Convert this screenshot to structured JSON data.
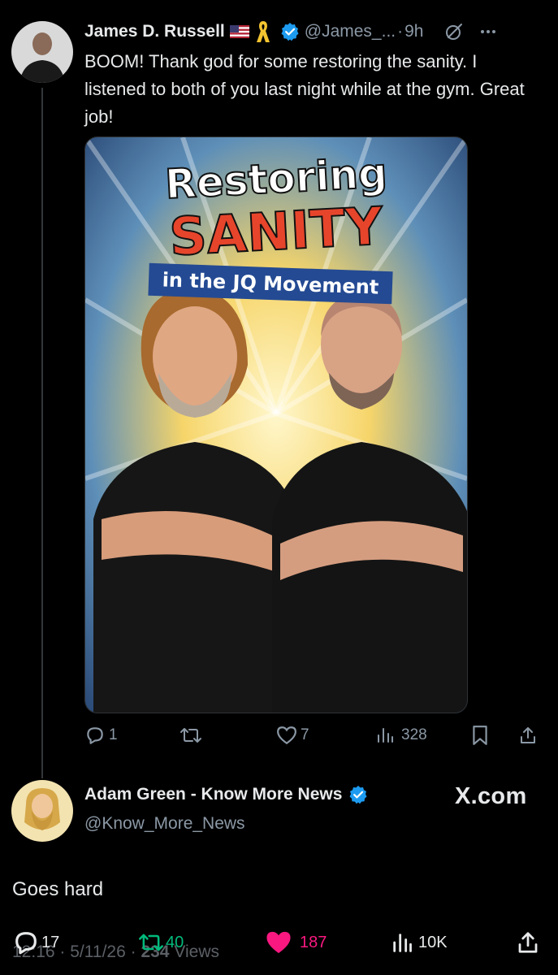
{
  "tweet1": {
    "author_name": "James D. Russell",
    "flag_icon": "us-flag-icon",
    "ribbon_icon": "ribbon-icon",
    "handle": "@James_...",
    "separator": "·",
    "time": "9h",
    "text": "BOOM! Thank god for some restoring the sanity. I listened to both of you last night while at the gym. Great job!",
    "media": {
      "title_line1": "Restoring",
      "title_line2": "SANITY",
      "banner": "in the JQ Movement"
    },
    "actions": {
      "replies": "1",
      "reposts": "",
      "likes": "7",
      "views": "328"
    }
  },
  "tweet2": {
    "author_name": "Adam Green - Know More News",
    "handle": "@Know_More_News",
    "brand": "X.com",
    "text": "Goes hard",
    "meta": {
      "time": "12:16",
      "date": "5/11/26",
      "views_count": "234",
      "views_label": "Views",
      "separator": "·"
    },
    "actions": {
      "replies": "17",
      "reposts": "40",
      "likes": "187",
      "views": "10K"
    }
  },
  "colors": {
    "background": "#000000",
    "text_primary": "#e7e9ea",
    "text_muted": "#8b98a5",
    "verified_blue": "#1d9bf0",
    "repost_green": "#00ba7c",
    "like_pink": "#f91880"
  }
}
